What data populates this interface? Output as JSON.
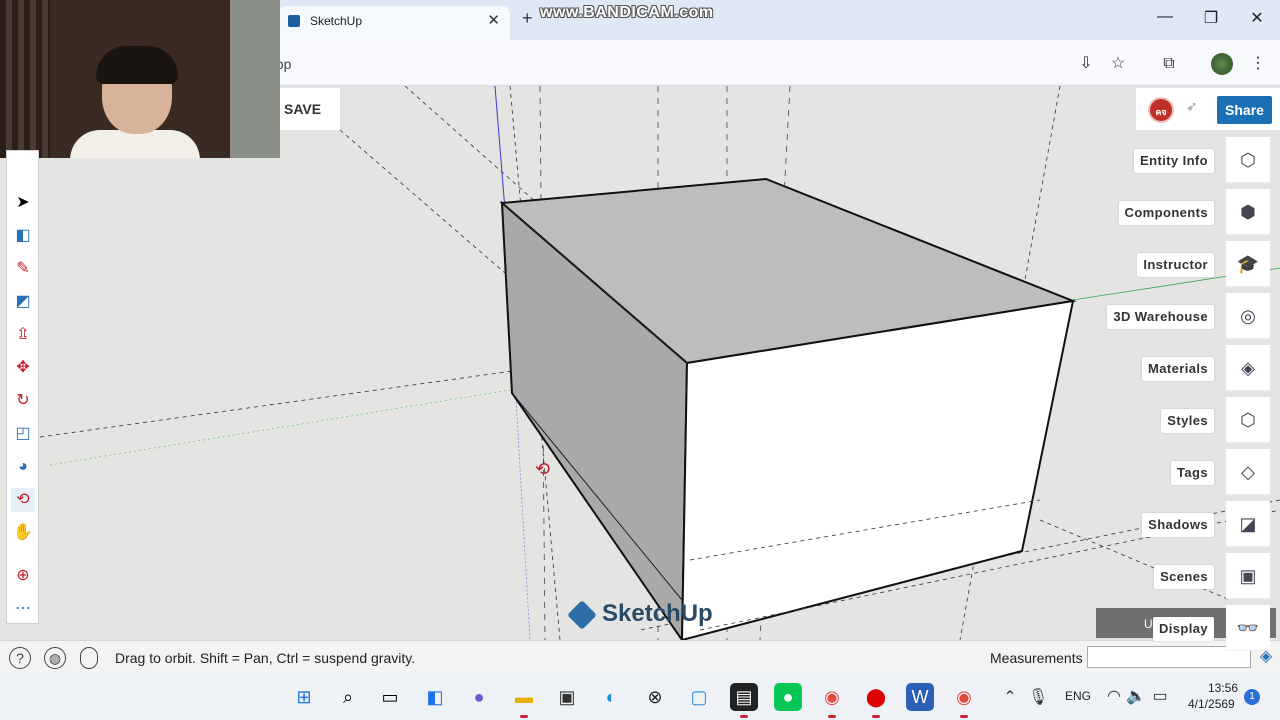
{
  "browser": {
    "tab_title": "SketchUp",
    "tab_close": "✕",
    "new_tab": "+",
    "url_fragment": "app",
    "watermark": "www.BANDICAM.com",
    "window_buttons": [
      "—",
      "❐",
      "✕"
    ]
  },
  "app": {
    "save_label": "SAVE",
    "user_initials": "คจ",
    "share_label": "Share",
    "logo_text": "SketchUp",
    "panels": [
      {
        "label": "Entity Info",
        "icon": "entity-info-icon",
        "glyph": "⬡"
      },
      {
        "label": "Components",
        "icon": "components-icon",
        "glyph": "⬢"
      },
      {
        "label": "Instructor",
        "icon": "instructor-icon",
        "glyph": "🎓"
      },
      {
        "label": "3D Warehouse",
        "icon": "warehouse-icon",
        "glyph": "◎"
      },
      {
        "label": "Materials",
        "icon": "materials-icon",
        "glyph": "◈"
      },
      {
        "label": "Styles",
        "icon": "styles-icon",
        "glyph": "⬡"
      },
      {
        "label": "Tags",
        "icon": "tags-icon",
        "glyph": "◇"
      },
      {
        "label": "Shadows",
        "icon": "shadows-icon",
        "glyph": "◪"
      },
      {
        "label": "Scenes",
        "icon": "scenes-icon",
        "glyph": "▣"
      },
      {
        "label": "Display",
        "icon": "display-icon",
        "glyph": "👓"
      }
    ],
    "display_chip_text": "U     ow"
  },
  "status": {
    "hint": "Drag to orbit. Shift = Pan, Ctrl = suspend gravity.",
    "measurements_label": "Measurements",
    "measurements_value": ""
  },
  "taskbar": {
    "lang": "ENG",
    "time": "13:56",
    "date": "4/1/2569",
    "notifications": "1"
  }
}
